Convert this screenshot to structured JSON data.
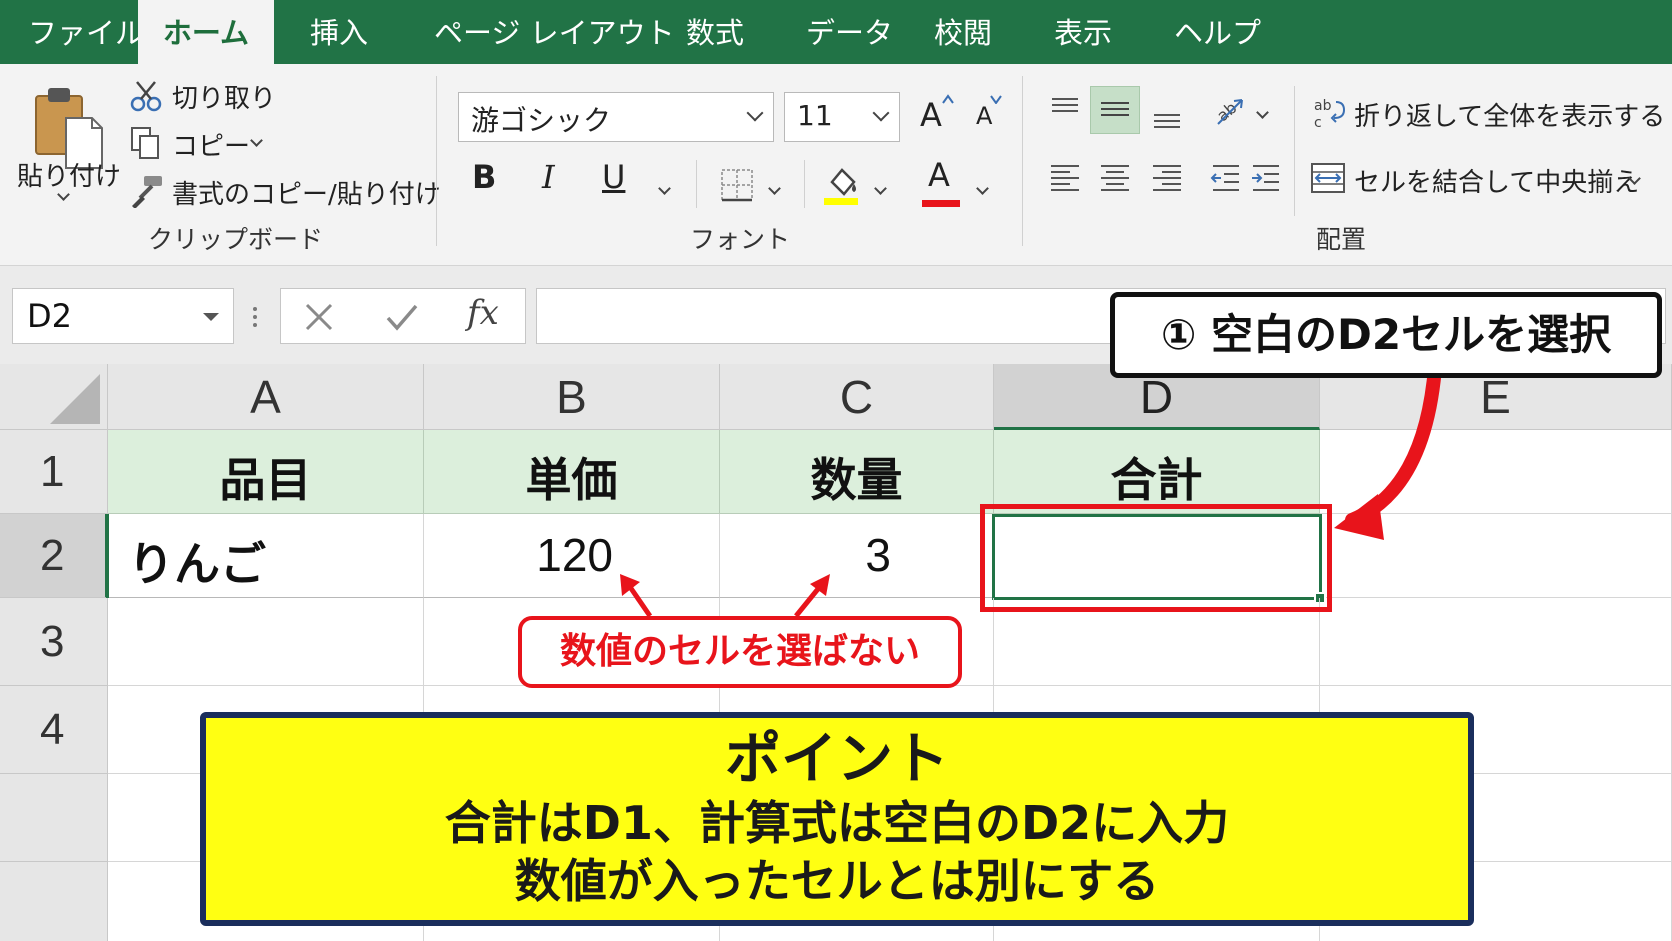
{
  "tabs": [
    {
      "label": "ファイル"
    },
    {
      "label": "ホーム",
      "active": true
    },
    {
      "label": "挿入"
    },
    {
      "label": "ページ レイアウト"
    },
    {
      "label": "数式"
    },
    {
      "label": "データ"
    },
    {
      "label": "校閲"
    },
    {
      "label": "表示"
    },
    {
      "label": "ヘルプ"
    }
  ],
  "ribbon": {
    "clipboard": {
      "paste_label": "貼り付け",
      "cut_label": "切り取り",
      "copy_label": "コピー",
      "format_painter_label": "書式のコピー/貼り付け",
      "group_label": "クリップボード"
    },
    "font": {
      "font_name": "游ゴシック",
      "font_size": "11",
      "grow_label": "A",
      "shrink_label": "A",
      "bold_label": "B",
      "italic_label": "I",
      "underline_label": "U",
      "font_color_label": "A",
      "group_label": "フォント",
      "highlight_color": "#ffff00",
      "font_color": "#e8141b"
    },
    "alignment": {
      "wrap_text_label": "折り返して全体を表示する",
      "merge_center_label": "セルを結合して中央揃え",
      "group_label": "配置"
    }
  },
  "formula_bar": {
    "name_box": "D2",
    "fx_label": "fx",
    "formula": ""
  },
  "sheet": {
    "columns": [
      "A",
      "B",
      "C",
      "D",
      "E"
    ],
    "selected_column": "D",
    "rows": [
      "1",
      "2",
      "3",
      "4"
    ],
    "selected_row": "2",
    "header_cells": [
      "品目",
      "単価",
      "数量",
      "合計"
    ],
    "data_row": {
      "item": "りんご",
      "price": "120",
      "qty": "3",
      "total": ""
    }
  },
  "annotations": {
    "step1": "① 空白のD2セルを選択",
    "warning": "数値のセルを選ばない",
    "point_title": "ポイント",
    "point_line1": "合計はD1、計算式は空白のD2に入力",
    "point_line2": "数値が入ったセルとは別にする"
  },
  "colors": {
    "excel_green": "#217346",
    "header_fill": "#dcefdc",
    "annotation_red": "#e8141b",
    "point_fill": "#ffff12",
    "point_border": "#1a2e5c"
  }
}
